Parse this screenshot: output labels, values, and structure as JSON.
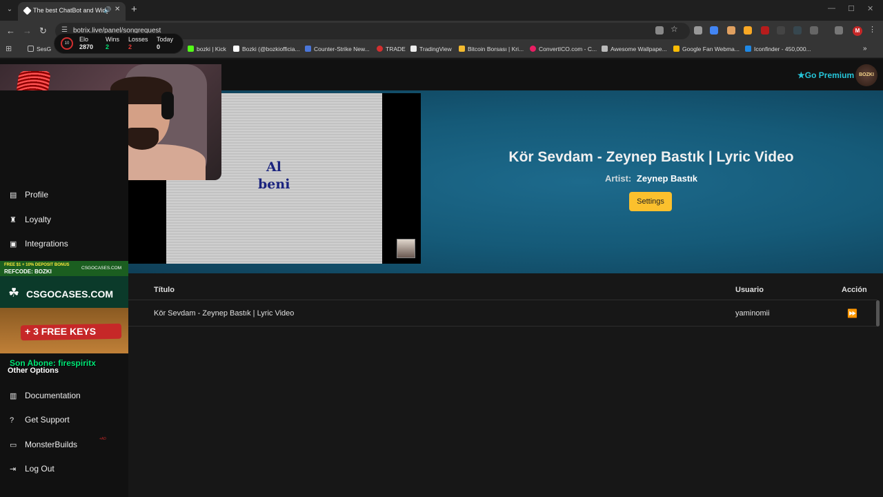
{
  "browser": {
    "tab_title": "The best ChatBot and Widg",
    "url": "botrix.live/panel/songrequest",
    "profile_initial": "M",
    "bookmarks": [
      {
        "label": "SesG",
        "color": "#888888"
      },
      {
        "label": "bozki | Kick",
        "color": "#53fc18"
      },
      {
        "label": "Bozki (@bozkiofficia...",
        "color": "#ffffff"
      },
      {
        "label": "Counter-Strike New...",
        "color": "#4a76d9"
      },
      {
        "label": "TRADE",
        "color": "#d32f2f"
      },
      {
        "label": "TradingView",
        "color": "#eeeeee"
      },
      {
        "label": "Bitcoin Borsası | Kri...",
        "color": "#f3ba2f"
      },
      {
        "label": "ConvertICO.com - C...",
        "color": "#e91e63"
      },
      {
        "label": "Awesome Wallpape...",
        "color": "#bbbbbb"
      },
      {
        "label": "Google Fan Webma...",
        "color": "#fbbc05"
      },
      {
        "label": "Iconfinder - 450,000...",
        "color": "#1e88e5"
      }
    ]
  },
  "elo_widget": {
    "rank": "10",
    "elo_label": "Elo",
    "elo_value": "2870",
    "wins_label": "Wins",
    "wins_value": "2",
    "losses_label": "Losses",
    "losses_value": "2",
    "today_label": "Today",
    "today_value": "0"
  },
  "header": {
    "premium_label": "Go Premium",
    "avatar_text": "BOZKI"
  },
  "sidebar": {
    "items": [
      {
        "label": "Profile",
        "icon": "id-card-icon"
      },
      {
        "label": "Loyalty",
        "icon": "trophy-icon"
      },
      {
        "label": "Integrations",
        "icon": "window-icon"
      }
    ],
    "other_options_title": "Other Options",
    "other_items": [
      {
        "label": "Documentation",
        "icon": "scroll-icon"
      },
      {
        "label": "Get Support",
        "icon": "question-icon"
      },
      {
        "label": "MonsterBuilds",
        "icon": "laptop-icon"
      },
      {
        "label": "Log Out",
        "icon": "logout-icon"
      }
    ]
  },
  "promo": {
    "top_small": "FREE $1 + 10% DEPOSIT BONUS",
    "refcode": "REFCODE: BOZKI",
    "brand_small": "CSGOCASES.COM",
    "brand": "CSGOCASES.COM",
    "keys": "+ 3  FREE  KEYS",
    "last_sub": "Son Abone: firespiritx",
    "ad_mark": "+AD"
  },
  "now_playing": {
    "title": "Kör Sevdam - Zeynep Bastık | Lyric Video",
    "artist_label": "Artist:",
    "artist": "Zeynep Bastık",
    "settings_label": "Settings",
    "lyric_line1": "Al",
    "lyric_line2": "beni"
  },
  "queue": {
    "columns": {
      "title": "Título",
      "user": "Usuario",
      "action": "Acción"
    },
    "rows": [
      {
        "title": "Kör Sevdam - Zeynep Bastık | Lyric Video",
        "user": "yaminomii"
      }
    ]
  },
  "colors": {
    "accent": "#26c6da",
    "settings": "#fbc02d",
    "hero": "#1d6a8c"
  }
}
